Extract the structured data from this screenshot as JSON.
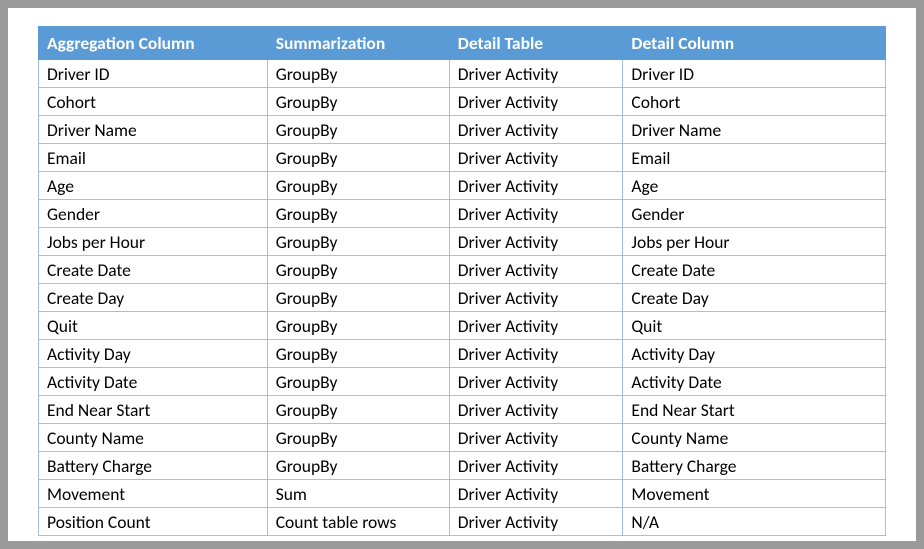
{
  "headers": {
    "aggregation_column": "Aggregation Column",
    "summarization": "Summarization",
    "detail_table": "Detail Table",
    "detail_column": "Detail Column"
  },
  "rows": [
    {
      "aggregation_column": "Driver ID",
      "summarization": "GroupBy",
      "detail_table": "Driver Activity",
      "detail_column": "Driver ID"
    },
    {
      "aggregation_column": "Cohort",
      "summarization": "GroupBy",
      "detail_table": "Driver Activity",
      "detail_column": "Cohort"
    },
    {
      "aggregation_column": "Driver Name",
      "summarization": "GroupBy",
      "detail_table": "Driver Activity",
      "detail_column": "Driver Name"
    },
    {
      "aggregation_column": "Email",
      "summarization": "GroupBy",
      "detail_table": "Driver Activity",
      "detail_column": "Email"
    },
    {
      "aggregation_column": "Age",
      "summarization": "GroupBy",
      "detail_table": "Driver Activity",
      "detail_column": "Age"
    },
    {
      "aggregation_column": "Gender",
      "summarization": "GroupBy",
      "detail_table": "Driver Activity",
      "detail_column": "Gender"
    },
    {
      "aggregation_column": "Jobs per Hour",
      "summarization": "GroupBy",
      "detail_table": "Driver Activity",
      "detail_column": "Jobs per Hour"
    },
    {
      "aggregation_column": "Create Date",
      "summarization": "GroupBy",
      "detail_table": "Driver Activity",
      "detail_column": "Create Date"
    },
    {
      "aggregation_column": "Create Day",
      "summarization": "GroupBy",
      "detail_table": "Driver Activity",
      "detail_column": "Create Day"
    },
    {
      "aggregation_column": "Quit",
      "summarization": "GroupBy",
      "detail_table": "Driver Activity",
      "detail_column": "Quit"
    },
    {
      "aggregation_column": "Activity Day",
      "summarization": "GroupBy",
      "detail_table": "Driver Activity",
      "detail_column": "Activity Day"
    },
    {
      "aggregation_column": "Activity Date",
      "summarization": "GroupBy",
      "detail_table": "Driver Activity",
      "detail_column": "Activity Date"
    },
    {
      "aggregation_column": "End Near Start",
      "summarization": "GroupBy",
      "detail_table": "Driver Activity",
      "detail_column": "End Near Start"
    },
    {
      "aggregation_column": "County Name",
      "summarization": "GroupBy",
      "detail_table": "Driver Activity",
      "detail_column": "County Name"
    },
    {
      "aggregation_column": "Battery Charge",
      "summarization": "GroupBy",
      "detail_table": "Driver Activity",
      "detail_column": "Battery Charge"
    },
    {
      "aggregation_column": "Movement",
      "summarization": "Sum",
      "detail_table": "Driver Activity",
      "detail_column": "Movement"
    },
    {
      "aggregation_column": "Position Count",
      "summarization": "Count table rows",
      "detail_table": "Driver Activity",
      "detail_column": "N/A"
    }
  ]
}
